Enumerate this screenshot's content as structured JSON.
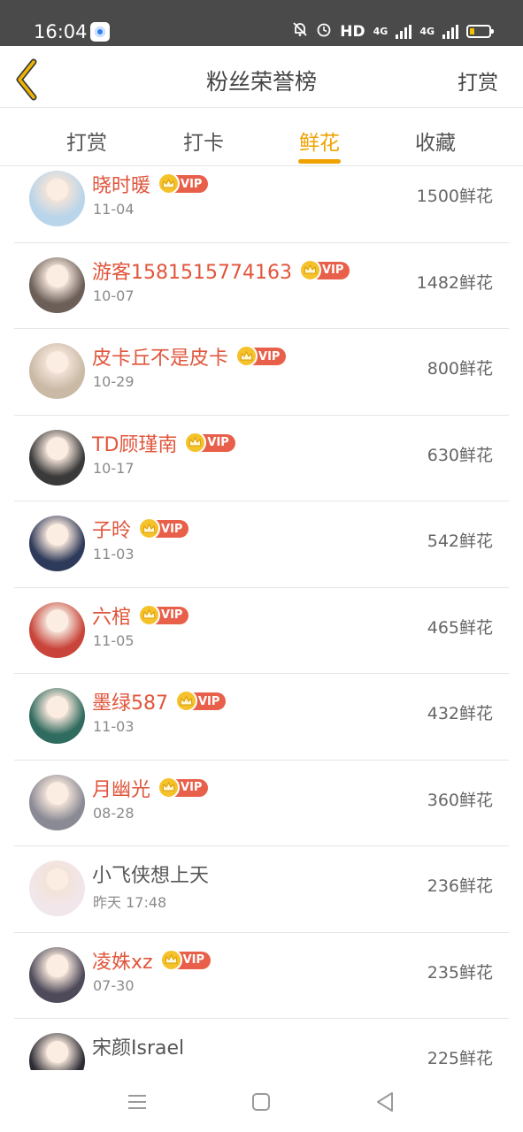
{
  "status_bar": {
    "time": "16:04",
    "hd_label": "HD",
    "net1_label": "4G",
    "net2_label": "4G"
  },
  "header": {
    "title": "粉丝荣誉榜",
    "action_label": "打赏"
  },
  "tabs": [
    {
      "label": "打赏",
      "active": false
    },
    {
      "label": "打卡",
      "active": false
    },
    {
      "label": "鲜花",
      "active": true
    },
    {
      "label": "收藏",
      "active": false
    }
  ],
  "vip_label": "VIP",
  "colors": {
    "accent": "#f0a200",
    "name_vip": "#e0553b",
    "vip_badge": "#e8604a",
    "crown": "#f6c22c"
  },
  "fans": [
    {
      "name": "晓时暖",
      "date": "11-04",
      "amount": "1500鲜花",
      "vip": true,
      "avatar_color": "#b9d5ea"
    },
    {
      "name": "游客1581515774163",
      "date": "10-07",
      "amount": "1482鲜花",
      "vip": true,
      "avatar_color": "#6b5f58"
    },
    {
      "name": "皮卡丘不是皮卡",
      "date": "10-29",
      "amount": "800鲜花",
      "vip": true,
      "avatar_color": "#c9b9a5"
    },
    {
      "name": "TD顾瑾南",
      "date": "10-17",
      "amount": "630鲜花",
      "vip": true,
      "avatar_color": "#3a3a3a"
    },
    {
      "name": "子昤",
      "date": "11-03",
      "amount": "542鲜花",
      "vip": true,
      "avatar_color": "#2e3a5a"
    },
    {
      "name": "六棺",
      "date": "11-05",
      "amount": "465鲜花",
      "vip": true,
      "avatar_color": "#c9443a"
    },
    {
      "name": "墨绿587",
      "date": "11-03",
      "amount": "432鲜花",
      "vip": true,
      "avatar_color": "#2f6b5e"
    },
    {
      "name": "月幽光",
      "date": "08-28",
      "amount": "360鲜花",
      "vip": true,
      "avatar_color": "#8a8a95"
    },
    {
      "name": "小飞侠想上天",
      "date": "昨天 17:48",
      "amount": "236鲜花",
      "vip": false,
      "avatar_color": "#f1e6ea"
    },
    {
      "name": "凌姝xz",
      "date": "07-30",
      "amount": "235鲜花",
      "vip": true,
      "avatar_color": "#4e4a5a"
    },
    {
      "name": "宋颜Israel",
      "date": "",
      "amount": "225鲜花",
      "vip": false,
      "avatar_color": "#2c2c34"
    }
  ]
}
